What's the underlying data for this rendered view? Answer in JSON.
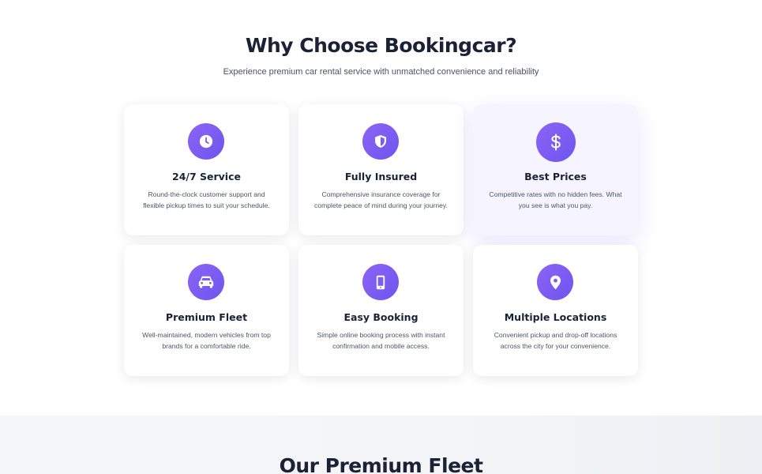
{
  "why": {
    "title": "Why Choose Bookingcar?",
    "subtitle": "Experience premium car rental service with unmatched convenience and reliability"
  },
  "features": [
    {
      "title": "24/7 Service",
      "description": "Round-the-clock customer support and flexible pickup times to suit your schedule.",
      "icon": "clock-icon"
    },
    {
      "title": "Fully Insured",
      "description": "Comprehensive insurance coverage for complete peace of mind during your journey.",
      "icon": "shield-icon"
    },
    {
      "title": "Best Prices",
      "description": "Competitive rates with no hidden fees. What you see is what you pay.",
      "icon": "dollar-icon"
    },
    {
      "title": "Premium Fleet",
      "description": "Well-maintained, modern vehicles from top brands for a comfortable ride.",
      "icon": "car-icon"
    },
    {
      "title": "Easy Booking",
      "description": "Simple online booking process with instant confirmation and mobile access.",
      "icon": "smartphone-icon"
    },
    {
      "title": "Multiple Locations",
      "description": "Convenient pickup and drop-off locations across the city for your convenience.",
      "icon": "map-pin-icon"
    }
  ],
  "fleet": {
    "title": "Our Premium Fleet"
  },
  "colors": {
    "accent_start": "#8d63f6",
    "accent_end": "#6d56ee",
    "heading": "#1b2236",
    "body_text": "#4d5466",
    "highlight_card_bg": "#f6f4ff",
    "fleet_bg": "#f4f6f9"
  }
}
